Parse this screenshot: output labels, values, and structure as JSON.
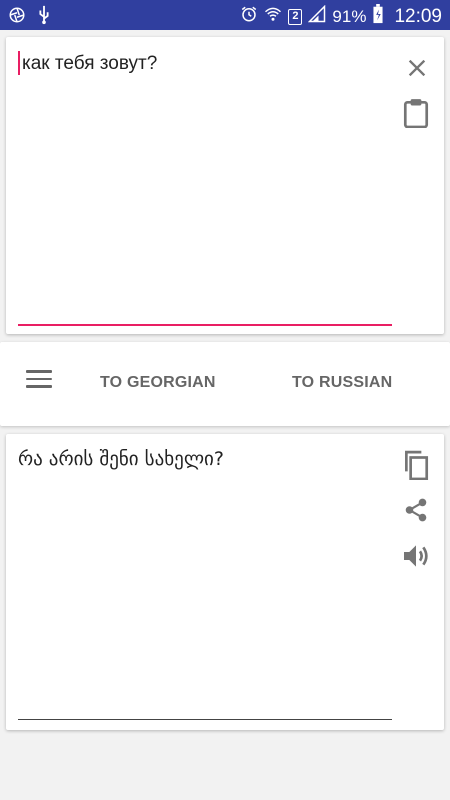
{
  "status_bar": {
    "battery_percent": "91%",
    "time": "12:09",
    "sim_badge": "2"
  },
  "input_card": {
    "text": "как тебя зовут?",
    "accent_color": "#e91e63"
  },
  "controls": {
    "tab_to_georgian": "TO GEORGIAN",
    "tab_to_russian": "TO RUSSIAN"
  },
  "output_card": {
    "text": "რა არის შენი სახელი?"
  },
  "colors": {
    "status_bar": "#303f9f",
    "icon_gray": "#757575",
    "accent": "#e91e63"
  },
  "icons": [
    "aperture-icon",
    "usb-icon",
    "alarm-icon",
    "wifi-icon",
    "sim-icon",
    "signal-icon",
    "battery-icon",
    "close-icon",
    "clipboard-icon",
    "menu-icon",
    "copy-icon",
    "share-icon",
    "speaker-icon"
  ]
}
